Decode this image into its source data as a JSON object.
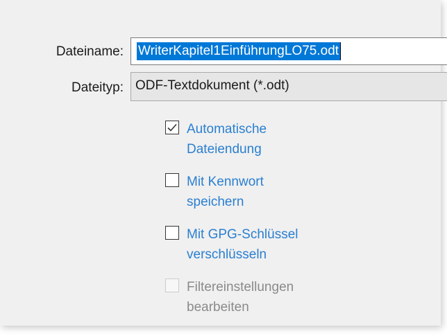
{
  "form": {
    "filename_label": "Dateiname:",
    "filename_value": "WriterKapitel1EinführungLO75.odt",
    "filetype_label": "Dateityp:",
    "filetype_value": "ODF-Textdokument (*.odt)"
  },
  "options": {
    "auto_extension": {
      "line1": "Automatische",
      "line2": "Dateiendung",
      "checked": true,
      "enabled": true
    },
    "save_with_password": {
      "line1": "Mit Kennwort",
      "line2": "speichern",
      "checked": false,
      "enabled": true
    },
    "encrypt_gpg": {
      "line1": "Mit GPG-Schlüssel",
      "line2": "verschlüsseln",
      "checked": false,
      "enabled": true
    },
    "edit_filter": {
      "line1": "Filtereinstellungen",
      "line2": "bearbeiten",
      "checked": false,
      "enabled": false
    }
  },
  "colors": {
    "selection": "#0078d7",
    "link_label": "#2a7fd0",
    "disabled_label": "#8a8a8a"
  }
}
